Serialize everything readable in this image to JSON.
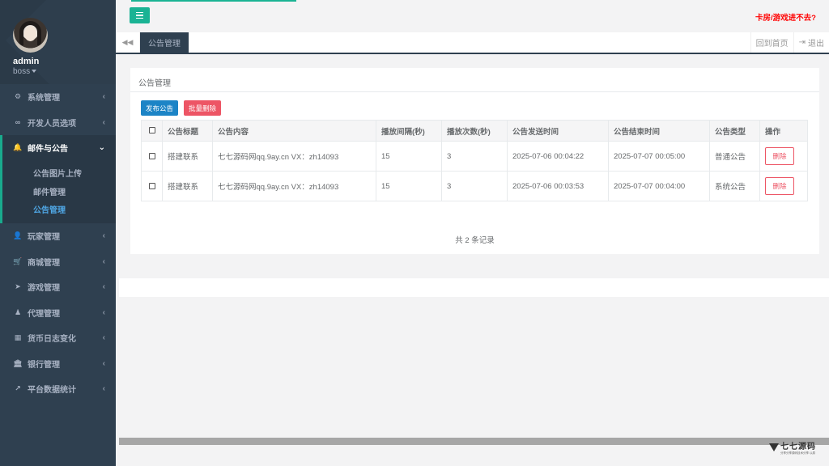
{
  "profile": {
    "name": "admin",
    "role": "boss"
  },
  "sidebar": {
    "items": [
      {
        "icon": "⚙",
        "label": "系统管理"
      },
      {
        "icon": "∞",
        "label": "开发人员选项"
      },
      {
        "icon": "🔔",
        "label": "邮件与公告",
        "open": true
      },
      {
        "icon": "👤",
        "label": "玩家管理"
      },
      {
        "icon": "🛒",
        "label": "商城管理"
      },
      {
        "icon": "➤",
        "label": "游戏管理"
      },
      {
        "icon": "♟",
        "label": "代理管理"
      },
      {
        "icon": "▦",
        "label": "货币日志变化"
      },
      {
        "icon": "🏛",
        "label": "银行管理"
      },
      {
        "icon": "↗",
        "label": "平台数据统计"
      }
    ],
    "subitems": [
      "公告图片上传",
      "邮件管理",
      "公告管理"
    ]
  },
  "topbar": {
    "warning": "卡房/游戏进不去?"
  },
  "tabs": {
    "active": "公告管理",
    "home": "回到首页",
    "logout": "退出"
  },
  "panel": {
    "title": "公告管理",
    "publish_btn": "发布公告",
    "batch_delete_btn": "批量删除",
    "columns": [
      "公告标题",
      "公告内容",
      "播放间隔(秒)",
      "播放次数(秒)",
      "公告发送时间",
      "公告结束时间",
      "公告类型",
      "操作"
    ],
    "rows": [
      [
        "搭建联系",
        "七七源码网qq.9ay.cn VX：zh14093",
        "15",
        "3",
        "2025-07-06 00:04:22",
        "2025-07-07 00:05:00",
        "普通公告",
        "删除"
      ],
      [
        "搭建联系",
        "七七源码网qq.9ay.cn VX：zh14093",
        "15",
        "3",
        "2025-07-06 00:03:53",
        "2025-07-07 00:04:00",
        "系统公告",
        "删除"
      ]
    ],
    "record_count": "共 2 条记录"
  },
  "watermark": {
    "title": "七七源码",
    "subtitle": "分享分享源码技术分享 以原"
  },
  "colors": {
    "sidebar": "#2f4050",
    "accent": "#1ab394",
    "primary": "#1c84c6",
    "danger": "#ed5565"
  }
}
